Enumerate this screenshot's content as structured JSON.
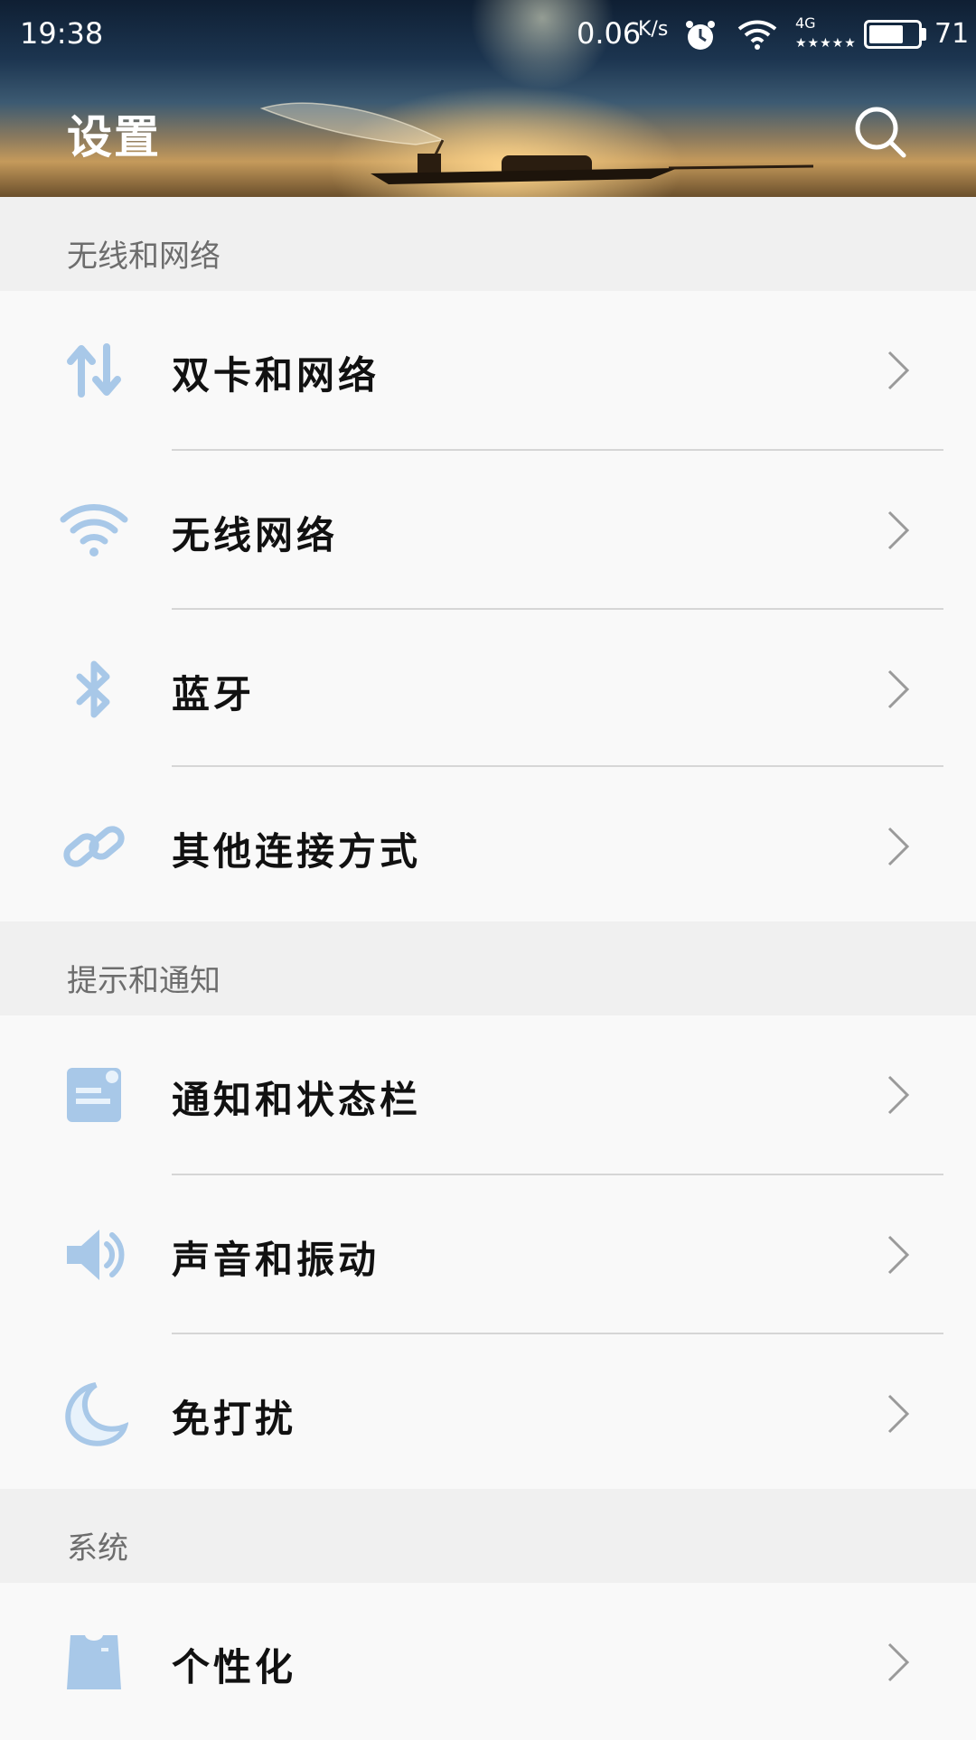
{
  "status_bar": {
    "time": "19:38",
    "net_speed": "0.06",
    "net_speed_unit": "K/s",
    "network_type": "4G",
    "signal": "★★★★★",
    "battery_level": "71",
    "battery_fraction": 0.71
  },
  "header": {
    "title": "设置"
  },
  "sections": [
    {
      "title": "无线和网络",
      "items": [
        {
          "label": "双卡和网络",
          "icon": "dual-sim-data-icon"
        },
        {
          "label": "无线网络",
          "icon": "wifi-icon"
        },
        {
          "label": "蓝牙",
          "icon": "bluetooth-icon"
        },
        {
          "label": "其他连接方式",
          "icon": "link-icon"
        }
      ]
    },
    {
      "title": "提示和通知",
      "items": [
        {
          "label": "通知和状态栏",
          "icon": "notification-icon"
        },
        {
          "label": "声音和振动",
          "icon": "speaker-icon"
        },
        {
          "label": "免打扰",
          "icon": "moon-icon"
        }
      ]
    },
    {
      "title": "系统",
      "items": [
        {
          "label": "个性化",
          "icon": "tshirt-icon"
        }
      ]
    }
  ],
  "colors": {
    "icon_tint": "#a8c8e8",
    "icon_glow": "#d8ecfb",
    "section_bg": "#f0f0f0",
    "row_bg": "#f9f9f9"
  }
}
